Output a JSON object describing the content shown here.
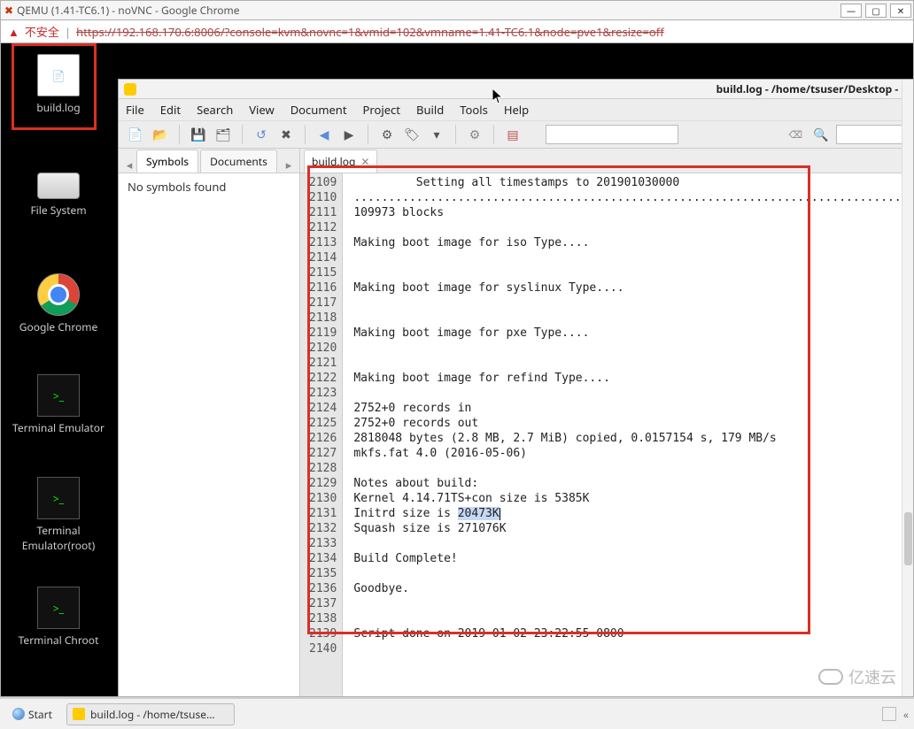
{
  "chrome": {
    "title": "QEMU (1.41-TC6.1) - noVNC - Google Chrome",
    "warn_text": "不安全",
    "url": "https://192.168.170.6:8006/?console=kvm&novnc=1&vmid=102&vmname=1.41-TC6.1&node=pve1&resize=off",
    "btn_min": "—",
    "btn_max": "▢",
    "btn_close": "✕"
  },
  "desktop_icons": {
    "build_log": "build.log",
    "file_system": "File System",
    "chrome": "Google Chrome",
    "terminal": "Terminal Emulator",
    "terminal_root": "Terminal Emulator(root)",
    "terminal_chroot": "Terminal Chroot"
  },
  "editor": {
    "title": "build.log - /home/tsuser/Desktop - G",
    "menu": [
      "File",
      "Edit",
      "Search",
      "View",
      "Document",
      "Project",
      "Build",
      "Tools",
      "Help"
    ],
    "side_tabs": {
      "symbols": "Symbols",
      "documents": "Documents"
    },
    "side_content": "No symbols found",
    "doc_tab": "build.log",
    "line_start": 2109,
    "lines": [
      "         Setting all timestamps to 201901030000",
      "...................................................................................",
      "109973 blocks",
      "",
      "Making boot image for iso Type....",
      "",
      "",
      "Making boot image for syslinux Type....",
      "",
      "",
      "Making boot image for pxe Type....",
      "",
      "",
      "Making boot image for refind Type....",
      "",
      "2752+0 records in",
      "2752+0 records out",
      "2818048 bytes (2.8 MB, 2.7 MiB) copied, 0.0157154 s, 179 MB/s",
      "mkfs.fat 4.0 (2016-05-06)",
      "",
      "Notes about build:",
      "Kernel 4.14.71TS+con size is 5385K",
      "Initrd size is ",
      "Squash size is 271076K",
      "",
      "Build Complete!",
      "",
      "Goodbye.",
      "",
      "",
      "Script done on 2019-01-02 23:22:55-0800",
      ""
    ],
    "highlight": "20473K"
  },
  "taskbar": {
    "start": "Start",
    "task_button": "build.log - /home/tsuse..."
  },
  "watermark": "亿速云"
}
